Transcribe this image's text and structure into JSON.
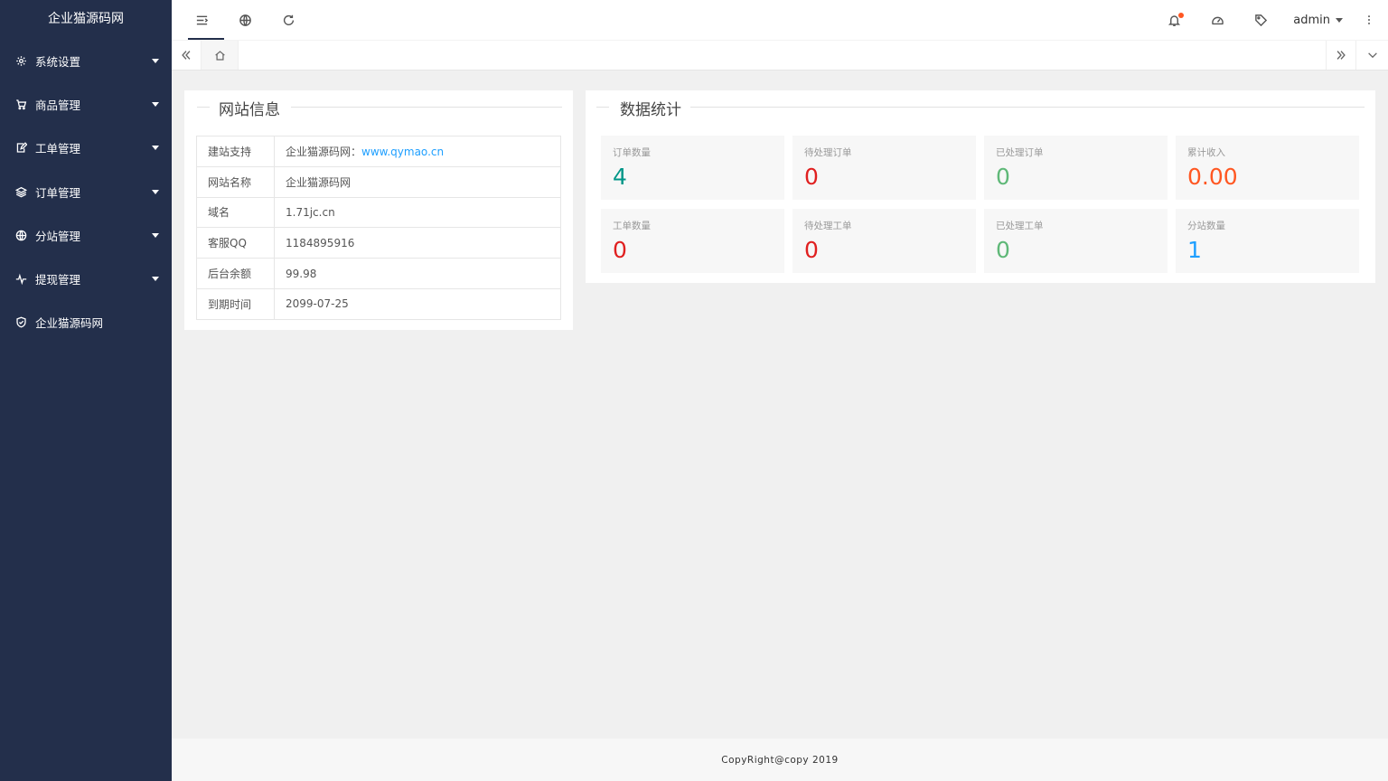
{
  "sidebar": {
    "logo": "企业猫源码网",
    "items": [
      {
        "label": "系统设置",
        "icon": "gear-icon",
        "has_caret": true
      },
      {
        "label": "商品管理",
        "icon": "cart-icon",
        "has_caret": true
      },
      {
        "label": "工单管理",
        "icon": "edit-icon",
        "has_caret": true
      },
      {
        "label": "订单管理",
        "icon": "layers-icon",
        "has_caret": true
      },
      {
        "label": "分站管理",
        "icon": "globe-icon",
        "has_caret": true
      },
      {
        "label": "提现管理",
        "icon": "pulse-icon",
        "has_caret": true
      },
      {
        "label": "企业猫源码网",
        "icon": "shield-icon",
        "has_caret": false
      }
    ]
  },
  "header": {
    "user": "admin",
    "icons": [
      "menu-toggle-icon",
      "globe-icon",
      "refresh-icon",
      "bell-icon",
      "dashboard-icon",
      "tag-icon",
      "more-vertical-icon"
    ]
  },
  "site_info": {
    "title": "网站信息",
    "rows": [
      {
        "key": "建站支持",
        "value": "企业猫源码网：",
        "link": "www.qymao.cn"
      },
      {
        "key": "网站名称",
        "value": "企业猫源码网"
      },
      {
        "key": "域名",
        "value": "1.71jc.cn"
      },
      {
        "key": "客服QQ",
        "value": "1184895916"
      },
      {
        "key": "后台余额",
        "value": "99.98"
      },
      {
        "key": "到期时间",
        "value": "2099-07-25"
      }
    ]
  },
  "stats": {
    "title": "数据统计",
    "items": [
      {
        "label": "订单数量",
        "value": "4",
        "color": "#009688"
      },
      {
        "label": "待处理订单",
        "value": "0",
        "color": "#e02020"
      },
      {
        "label": "已处理订单",
        "value": "0",
        "color": "#5fb878"
      },
      {
        "label": "累计收入",
        "value": "0.00",
        "color": "#ff5722"
      },
      {
        "label": "工单数量",
        "value": "0",
        "color": "#e02020"
      },
      {
        "label": "待处理工单",
        "value": "0",
        "color": "#e02020"
      },
      {
        "label": "已处理工单",
        "value": "0",
        "color": "#5fb878"
      },
      {
        "label": "分站数量",
        "value": "1",
        "color": "#1e9fff"
      }
    ]
  },
  "footer": {
    "text": "CopyRight@copy 2019"
  }
}
